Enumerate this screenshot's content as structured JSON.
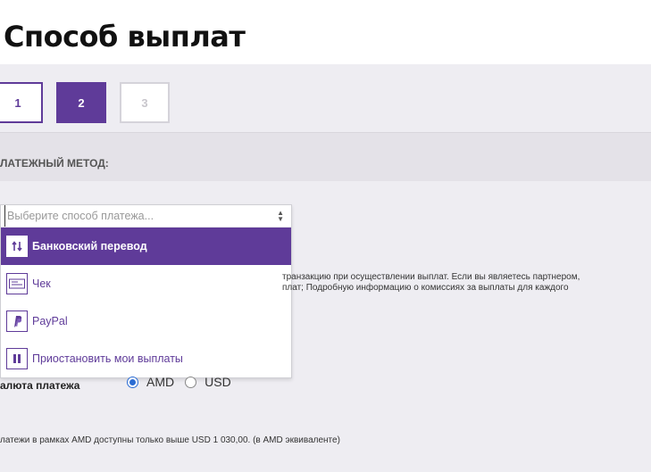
{
  "page": {
    "title": "Способ выплат"
  },
  "steps": [
    {
      "label": "1",
      "state": "done"
    },
    {
      "label": "2",
      "state": "active"
    },
    {
      "label": "3",
      "state": "pending"
    }
  ],
  "method_section": {
    "label": "ЛАТЕЖНЫЙ МЕТОД:"
  },
  "dropdown": {
    "placeholder": "Выберите способ платежа...",
    "options": [
      {
        "label": "Банковский перевод",
        "icon": "bank-transfer-icon",
        "selected": true
      },
      {
        "label": "Чек",
        "icon": "check-icon",
        "selected": false
      },
      {
        "label": "PayPal",
        "icon": "paypal-icon",
        "selected": false
      },
      {
        "label": "Приостановить мои выплаты",
        "icon": "pause-icon",
        "selected": false
      }
    ]
  },
  "info": {
    "line1": "транзакцию при осуществлении выплат. Если вы являетесь партнером,",
    "line2": "плат; Подробную информацию о комиссиях за выплаты для каждого"
  },
  "currency": {
    "label": "алюта платежа",
    "options": [
      {
        "label": "AMD",
        "checked": true
      },
      {
        "label": "USD",
        "checked": false
      }
    ]
  },
  "note": "латежи в рамках AMD доступны только выше USD 1 030,00. (в AMD эквиваленте)",
  "colors": {
    "accent": "#5f3b99",
    "background": "#eeedf2",
    "radio": "#2b6cd3"
  }
}
